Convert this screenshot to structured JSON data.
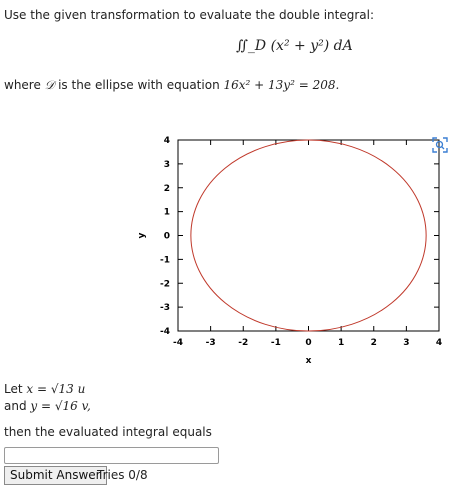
{
  "question": {
    "intro": "Use the given transformation to evaluate the double integral:",
    "integral_expr": "∬_D (x² + y²) dA",
    "region_prefix": "where",
    "region_symbol": "𝒟",
    "region_suffix": "is the ellipse with equation",
    "ellipse_equation": "16x² + 13y² = 208."
  },
  "transformation": {
    "line1_prefix": "Let",
    "line1_expr": "x = √13 u",
    "line2_prefix": "and",
    "line2_expr": "y = √16 v,",
    "result_prompt": "then the evaluated integral equals"
  },
  "answer": {
    "value": "",
    "submit_label": "Submit Answer",
    "tries": "Tries 0/8"
  },
  "chart_data": {
    "type": "line",
    "title": "",
    "xlabel": "x",
    "ylabel": "y",
    "xlim": [
      -4,
      4
    ],
    "ylim": [
      -4,
      4
    ],
    "xticks": [
      "-4",
      "-3",
      "-2",
      "-1",
      "0",
      "1",
      "2",
      "3",
      "4"
    ],
    "yticks": [
      "-4",
      "-3",
      "-2",
      "-1",
      "0",
      "1",
      "2",
      "3",
      "4"
    ],
    "series": [
      {
        "semi_axis_x": 3.6056,
        "semi_axis_y": 4,
        "color": "#c0392b"
      }
    ]
  },
  "icons": {
    "zoom": "zoom-icon"
  }
}
